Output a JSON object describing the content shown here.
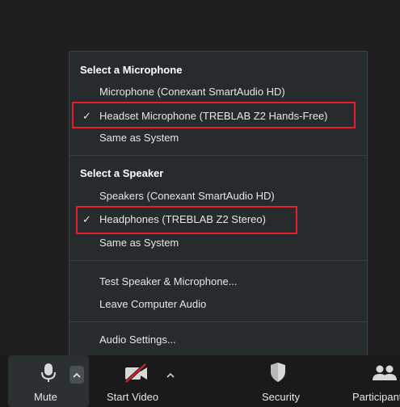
{
  "menu": {
    "microphone_header": "Select a Microphone",
    "microphone_options": [
      {
        "label": "Microphone (Conexant SmartAudio HD)",
        "selected": false
      },
      {
        "label": "Headset Microphone (TREBLAB Z2 Hands-Free)",
        "selected": true
      },
      {
        "label": "Same as System",
        "selected": false
      }
    ],
    "speaker_header": "Select a Speaker",
    "speaker_options": [
      {
        "label": "Speakers (Conexant SmartAudio HD)",
        "selected": false
      },
      {
        "label": "Headphones (TREBLAB Z2 Stereo)",
        "selected": true
      },
      {
        "label": "Same as System",
        "selected": false
      }
    ],
    "test_label": "Test Speaker & Microphone...",
    "leave_label": "Leave Computer Audio",
    "settings_label": "Audio Settings...",
    "check_glyph": "✓"
  },
  "toolbar": {
    "mute_label": "Mute",
    "start_video_label": "Start Video",
    "security_label": "Security",
    "participants_label": "Participants"
  },
  "colors": {
    "highlight": "#e5202a",
    "menu_bg": "#262b2e",
    "toolbar_bg": "#1a1a1a"
  },
  "icons": {
    "microphone": "microphone-icon",
    "video_off": "video-off-icon",
    "security": "shield-icon",
    "participants": "participants-icon",
    "caret": "chevron-up-icon",
    "check": "checkmark-icon"
  }
}
